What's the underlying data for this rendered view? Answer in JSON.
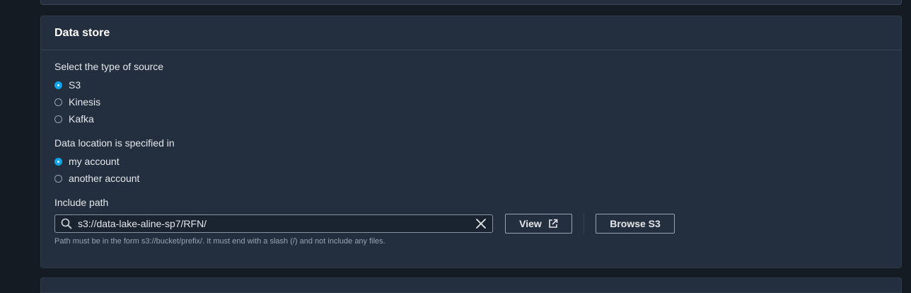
{
  "panel": {
    "title": "Data store"
  },
  "source_type": {
    "label": "Select the type of source",
    "options": [
      "S3",
      "Kinesis",
      "Kafka"
    ],
    "selected": "S3"
  },
  "data_location": {
    "label": "Data location is specified in",
    "options": [
      "my account",
      "another account"
    ],
    "selected": "my account"
  },
  "include_path": {
    "label": "Include path",
    "value": "s3://data-lake-aline-sp7/RFN/",
    "view_label": "View",
    "browse_label": "Browse S3",
    "hint": "Path must be in the form s3://bucket/prefix/. It must end with a slash (/) and not include any files."
  },
  "colors": {
    "accent": "#0ea5e9",
    "panel_bg": "#232f3e",
    "page_bg": "#151b23"
  }
}
